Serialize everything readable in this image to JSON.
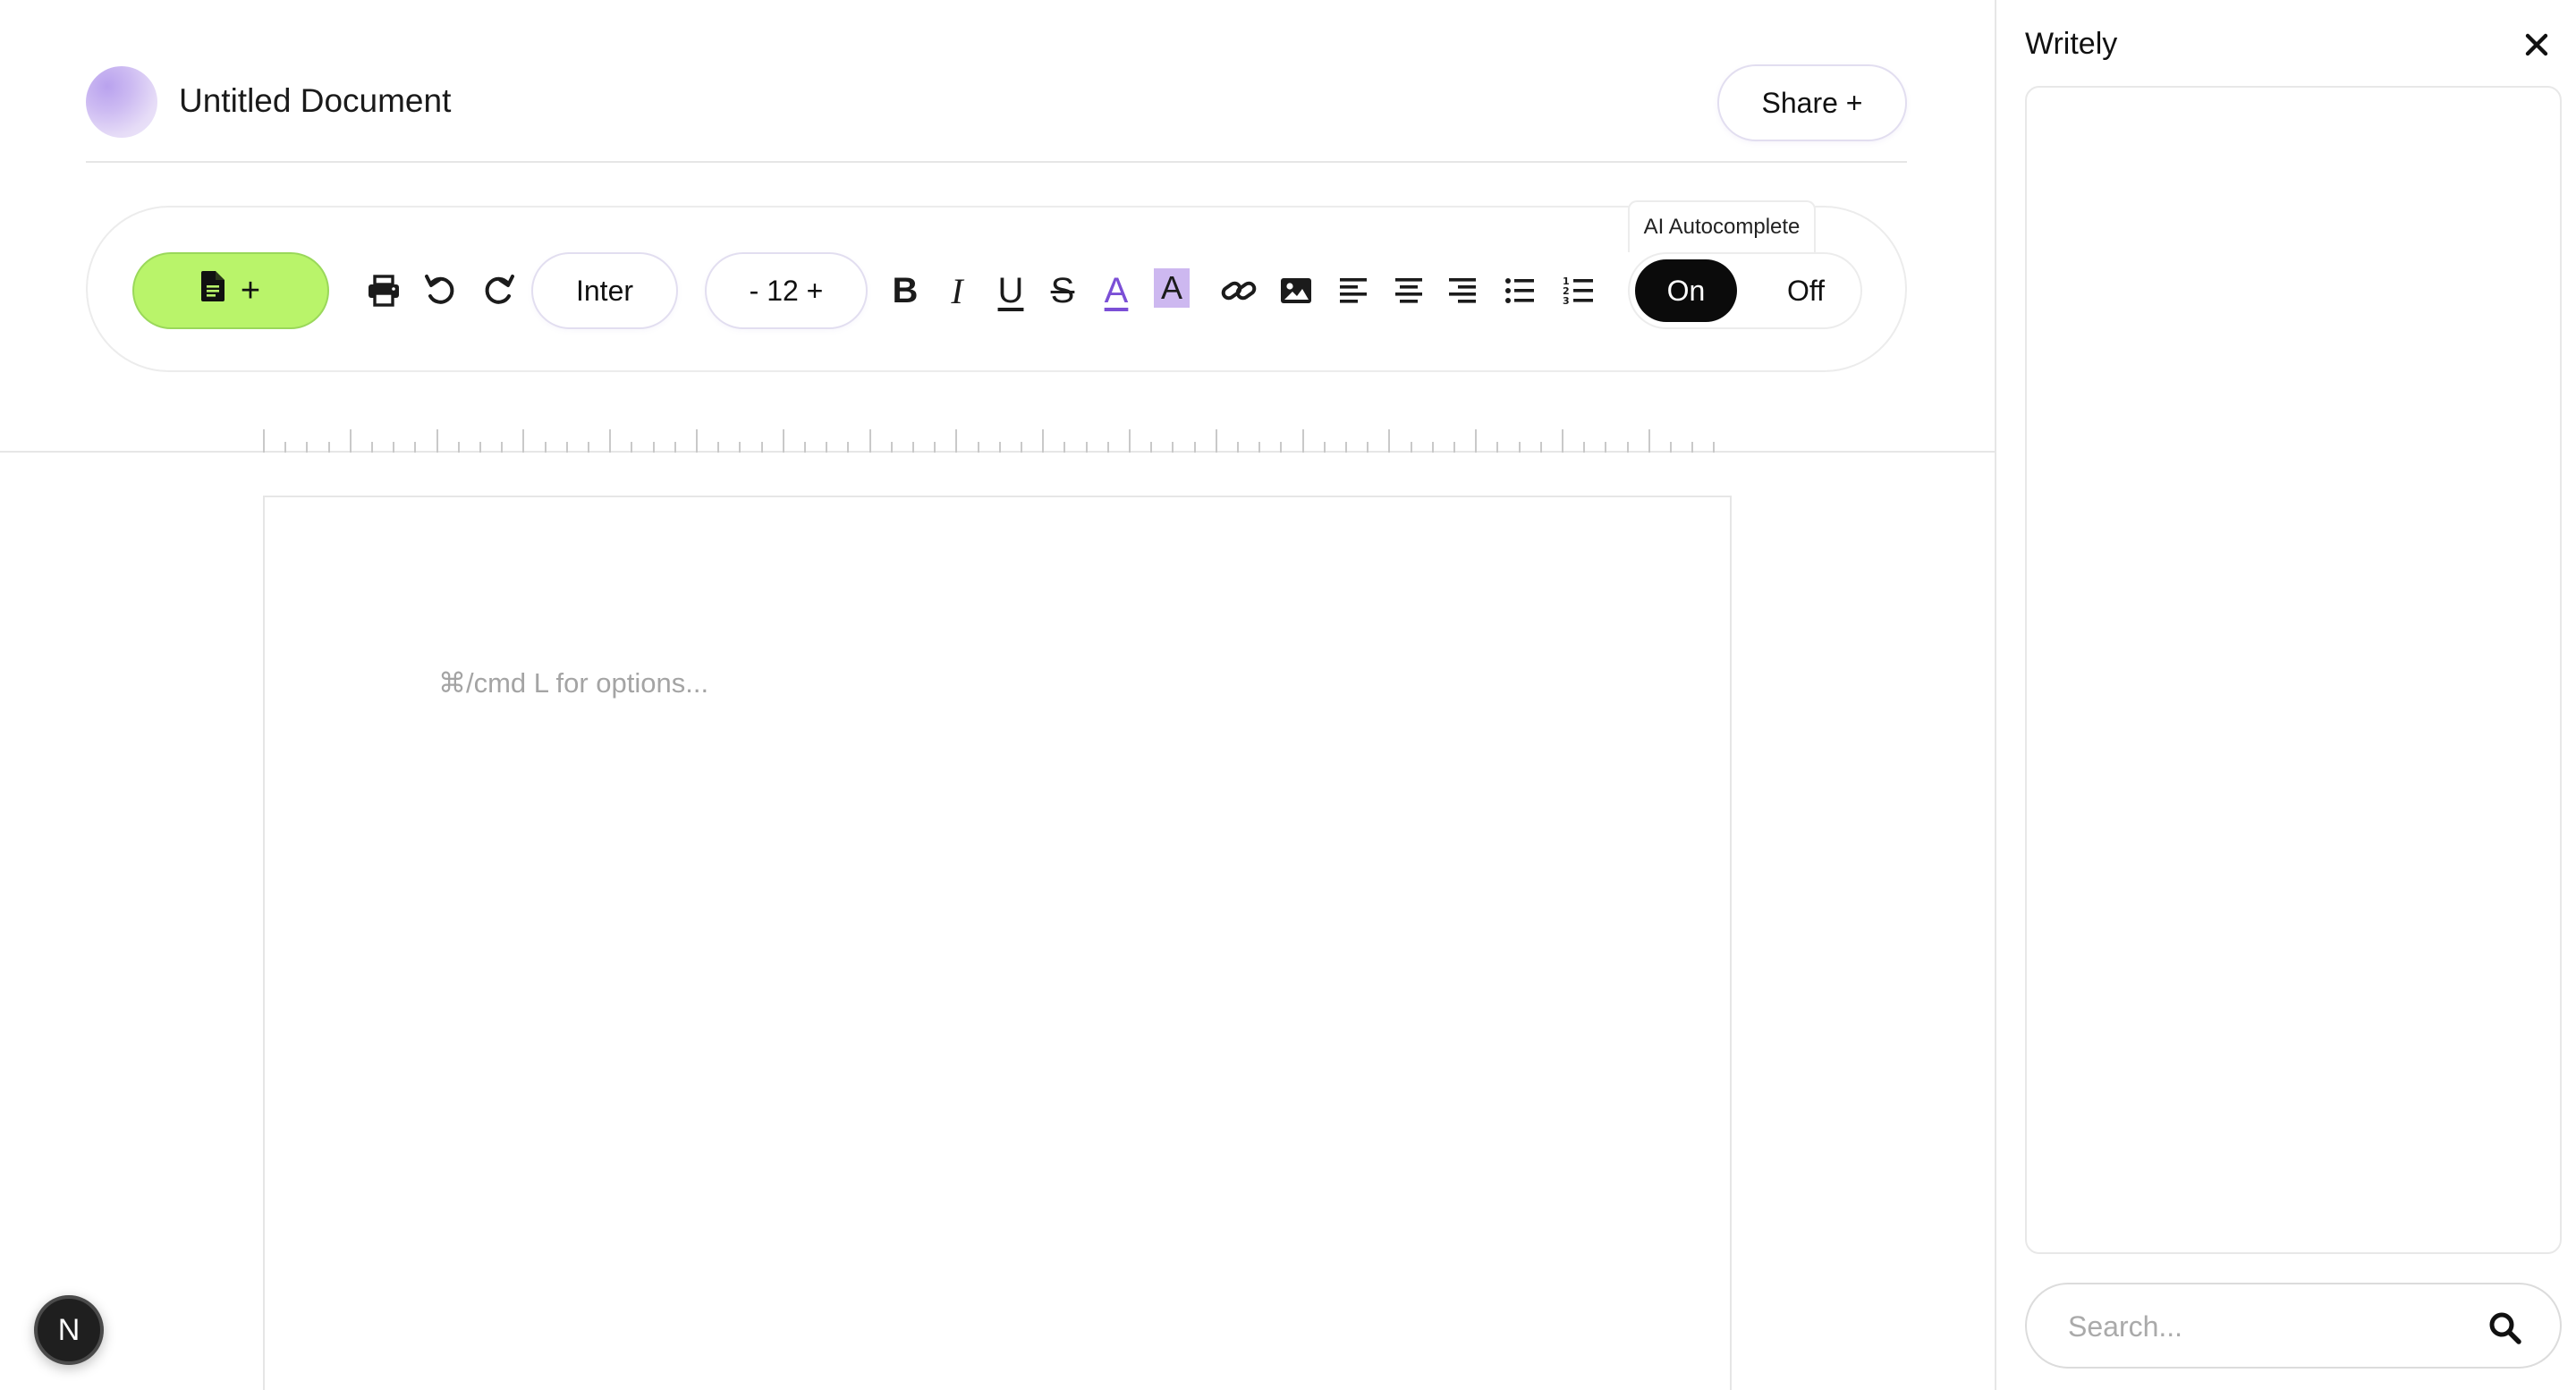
{
  "document": {
    "title": "Untitled Document",
    "share_label": "Share +"
  },
  "toolbar": {
    "new_doc_plus": "+",
    "font_family": "Inter",
    "font_size": "- 12 +",
    "bold": "B",
    "italic": "I",
    "underline": "U",
    "strikethrough": "S",
    "text_color": "A",
    "highlight": "A",
    "ai_autocomplete": {
      "label": "AI Autocomplete",
      "on": "On",
      "off": "Off",
      "selected": "On"
    },
    "icons": [
      "new-document-icon",
      "print-icon",
      "undo-icon",
      "redo-icon",
      "link-icon",
      "image-icon",
      "align-left-icon",
      "align-center-icon",
      "align-right-icon",
      "bullet-list-icon",
      "numbered-list-icon"
    ]
  },
  "page": {
    "placeholder": "⌘/cmd L for options..."
  },
  "badge": {
    "letter": "N"
  },
  "side_panel": {
    "title": "Writely",
    "search_placeholder": "Search..."
  },
  "colors": {
    "accent_green": "#b9f46a",
    "text_color_purple": "#7b4fd6",
    "highlight_purple": "#cdb8f0",
    "toggle_dark": "#0b0b0b"
  }
}
